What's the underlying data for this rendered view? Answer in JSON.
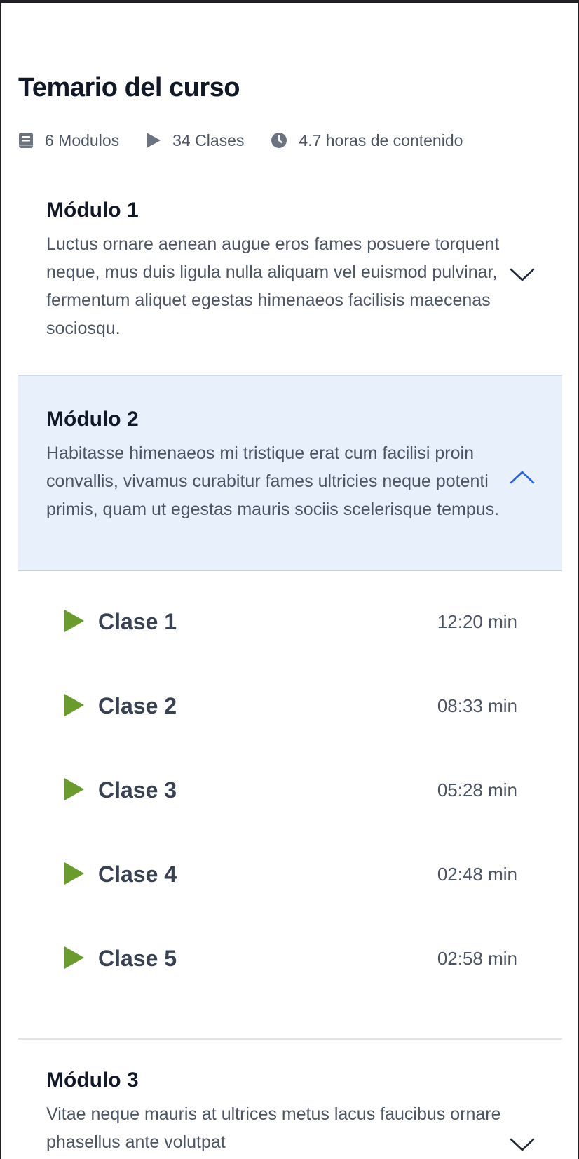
{
  "course": {
    "title": "Temario del curso",
    "stats": {
      "modules": "6 Modulos",
      "classes": "34 Clases",
      "duration": "4.7 horas de contenido"
    }
  },
  "modules": [
    {
      "title": "Módulo 1",
      "description": "Luctus ornare aenean augue eros fames posuere torquent neque, mus duis ligula nulla aliquam vel euismod pulvinar, fermentum aliquet egestas himenaeos facilisis maecenas sociosqu.",
      "expanded": false
    },
    {
      "title": "Módulo 2",
      "description": "Habitasse himenaeos mi tristique erat cum facilisi proin convallis, vivamus curabitur fames ultricies neque potenti primis, quam ut egestas mauris sociis scelerisque tempus.",
      "expanded": true,
      "lessons": [
        {
          "title": "Clase 1",
          "duration": "12:20 min"
        },
        {
          "title": "Clase 2",
          "duration": "08:33 min"
        },
        {
          "title": "Clase 3",
          "duration": "05:28 min"
        },
        {
          "title": "Clase 4",
          "duration": "02:48 min"
        },
        {
          "title": "Clase 5",
          "duration": "02:58 min"
        }
      ]
    },
    {
      "title": "Módulo 3",
      "description": "Vitae neque mauris at ultrices metus lacus faucibus ornare phasellus ante volutpat",
      "expanded": false
    }
  ],
  "colors": {
    "expanded_background": "#e8f0fc",
    "expanded_chevron": "#2563eb",
    "play_icon": "#6a9c2d"
  },
  "icons": {
    "modules": "book-icon",
    "classes": "play-icon",
    "duration": "clock-icon",
    "collapsed": "chevron-down-icon",
    "expanded": "chevron-up-icon",
    "lesson": "play-icon"
  }
}
